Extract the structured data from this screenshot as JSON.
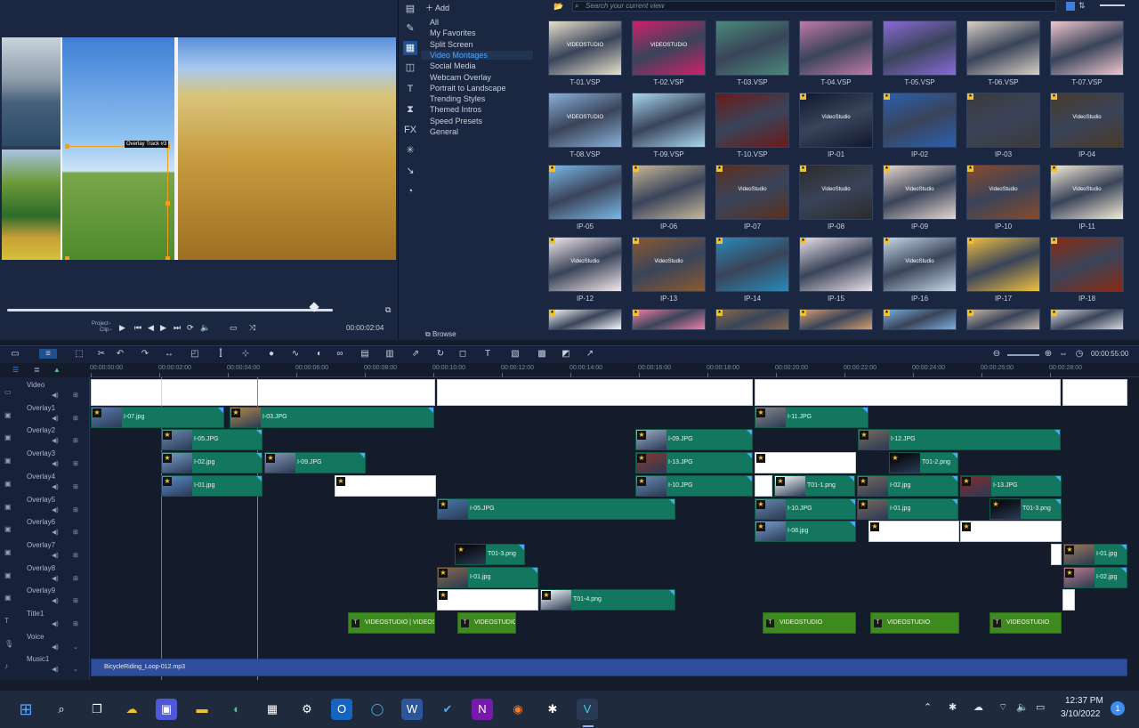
{
  "preview": {
    "overlay_label": "Overlay Track #3",
    "project_label": "Project−",
    "clip_label": "Clip−",
    "timecode": "00:00:02:04"
  },
  "library": {
    "add_label": "Add",
    "browse_label": "Browse",
    "search_placeholder": "Search your current view",
    "categories": [
      "All",
      "My Favorites",
      "Split Screen",
      "Video Montages",
      "Social Media",
      "Webcam Overlay",
      "Portrait to Landscape",
      "Trending Styles",
      "Themed Intros",
      "Speed Presets",
      "General"
    ],
    "active_category": "Video Montages",
    "thumbs": [
      {
        "label": "T-01.VSP",
        "text": "VIDEOSTUDIO",
        "color": "#e8e2cc"
      },
      {
        "label": "T-02.VSP",
        "text": "VIDEOSTUDIO",
        "color": "#d0206a"
      },
      {
        "label": "T-03.VSP",
        "text": "",
        "color": "#4a8a7a"
      },
      {
        "label": "T-04.VSP",
        "text": "",
        "color": "#c07aa8"
      },
      {
        "label": "T-05.VSP",
        "text": "",
        "color": "#8a6ad8"
      },
      {
        "label": "T-06.VSP",
        "text": "",
        "color": "#d8d0c4"
      },
      {
        "label": "T-07.VSP",
        "text": "",
        "color": "#f0c8d0"
      },
      {
        "label": "T-08.VSP",
        "text": "VIDEOSTUDIO",
        "color": "#8ab0d8"
      },
      {
        "label": "T-09.VSP",
        "text": "",
        "color": "#a8d8f0"
      },
      {
        "label": "T-10.VSP",
        "text": "",
        "color": "#6a1a1a"
      },
      {
        "label": "IP-01",
        "text": "VideoStudio",
        "color": "#101830"
      },
      {
        "label": "IP-02",
        "text": "",
        "color": "#2a60b0"
      },
      {
        "label": "IP-03",
        "text": "",
        "color": "#3a3a3a"
      },
      {
        "label": "IP-04",
        "text": "VideoStudio",
        "color": "#4a3a28"
      },
      {
        "label": "IP-05",
        "text": "",
        "color": "#7ab8e8"
      },
      {
        "label": "IP-06",
        "text": "",
        "color": "#c8b89a"
      },
      {
        "label": "IP-07",
        "text": "VideoStudio",
        "color": "#5a3020"
      },
      {
        "label": "IP-08",
        "text": "VideoStudio",
        "color": "#2a2a2a"
      },
      {
        "label": "IP-09",
        "text": "VideoStudio",
        "color": "#e8d8d0"
      },
      {
        "label": "IP-10",
        "text": "VideoStudio",
        "color": "#8a4a2a"
      },
      {
        "label": "IP-11",
        "text": "VideoStudio",
        "color": "#f4ecd8"
      },
      {
        "label": "IP-12",
        "text": "VideoStudio",
        "color": "#f4e8ec"
      },
      {
        "label": "IP-13",
        "text": "VideoStudio",
        "color": "#8a5a30"
      },
      {
        "label": "IP-14",
        "text": "",
        "color": "#2a8ab8"
      },
      {
        "label": "IP-15",
        "text": "",
        "color": "#e8e0e8"
      },
      {
        "label": "IP-16",
        "text": "VideoStudio",
        "color": "#c8d8e8"
      },
      {
        "label": "IP-17",
        "text": "",
        "color": "#f0c040"
      },
      {
        "label": "IP-18",
        "text": "",
        "color": "#8a2a10"
      },
      {
        "label": "",
        "text": "",
        "color": "#f8f8f8"
      },
      {
        "label": "",
        "text": "",
        "color": "#f080a8"
      },
      {
        "label": "",
        "text": "",
        "color": "#8a6a4a"
      },
      {
        "label": "",
        "text": "",
        "color": "#d8a070"
      },
      {
        "label": "",
        "text": "",
        "color": "#7ab0e0"
      },
      {
        "label": "",
        "text": "",
        "color": "#c8b8a8"
      },
      {
        "label": "",
        "text": "",
        "color": "#d8d8e0"
      }
    ]
  },
  "timeline": {
    "total_time": "00:00:55:00",
    "ruler": [
      "00:00:00:00",
      "00:00:02:00",
      "00:00:04:00",
      "00:00:06:00",
      "00:00:08:00",
      "00:00:10:00",
      "00:00:12:00",
      "00:00:14:00",
      "00:00:16:00",
      "00:00:18:00",
      "00:00:20:00",
      "00:00:22:00",
      "00:00:24:00",
      "00:00:26:00",
      "00:00:28:00"
    ],
    "tracks": [
      "Video",
      "Overlay1",
      "Overlay2",
      "Overlay3",
      "Overlay4",
      "Overlay5",
      "Overlay6",
      "Overlay7",
      "Overlay8",
      "Overlay9",
      "Title1",
      "Voice",
      "Music1"
    ],
    "music_clip": "BicycleRiding_Loop-012.mp3",
    "clips": {
      "o1a": "I-07.jpg",
      "o1b": "I-03.JPG",
      "o1c": "I-11.JPG",
      "o2a": "I-05.JPG",
      "o2b": "I-09.JPG",
      "o2c": "I-12.JPG",
      "o3a": "I-02.jpg",
      "o3b": "I-09.JPG",
      "o3c": "I-13.JPG",
      "o3d": "T01-2.png",
      "o4a": "I-01.jpg",
      "o4b": "I-10.JPG",
      "o4c": "T01-1.png",
      "o4d": "I-02.jpg",
      "o4e": "I-13.JPG",
      "o5a": "I-05.JPG",
      "o5b": "I-10.JPG",
      "o5c": "I-01.jpg",
      "o5d": "T01-3.png",
      "o6a": "I-08.jpg",
      "o7a": "T01-3.png",
      "o7b": "I-01.jpg",
      "o8a": "I-01.jpg",
      "o8b": "I-02.jpg",
      "o9a": "T01-4.png",
      "t1": "VIDEOSTUDIO | VIDEOS",
      "t2": "VIDEOSTUDIO",
      "t3": "VIDEOSTUDIO",
      "t4": "VIDEOSTUDIO",
      "t5": "VIDEOSTUDIO"
    }
  },
  "taskbar": {
    "time": "12:37 PM",
    "date": "3/10/2022",
    "notifications": "1"
  }
}
